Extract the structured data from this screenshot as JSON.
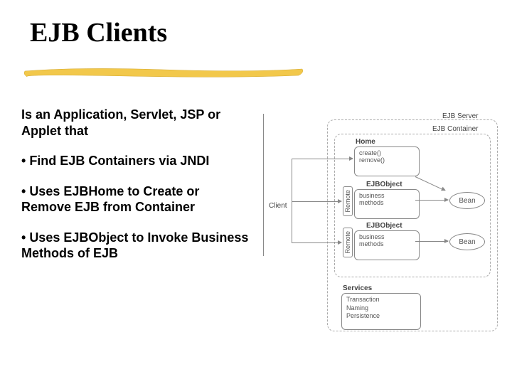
{
  "title": "EJB Clients",
  "subtitle": "Is an Application, Servlet, JSP or Applet that",
  "bullets": [
    "Find EJB Containers via JNDI",
    "Uses EJBHome to Create or Remove EJB from Container",
    "Uses EJBObject to Invoke Business Methods of EJB"
  ],
  "diagram": {
    "server": "EJB Server",
    "container": "EJB Container",
    "client": "Client",
    "home": "Home",
    "home_methods": "create()\nremove()",
    "ejbobject1": "EJBObject",
    "ejbobject1_methods": "business\nmethods",
    "ejbobject2": "EJBObject",
    "ejbobject2_methods": "business\nmethods",
    "remote": "Remote",
    "bean": "Bean",
    "bean2": "Bean",
    "services": "Services",
    "service_list": "Transaction\nNaming\nPersistence"
  }
}
